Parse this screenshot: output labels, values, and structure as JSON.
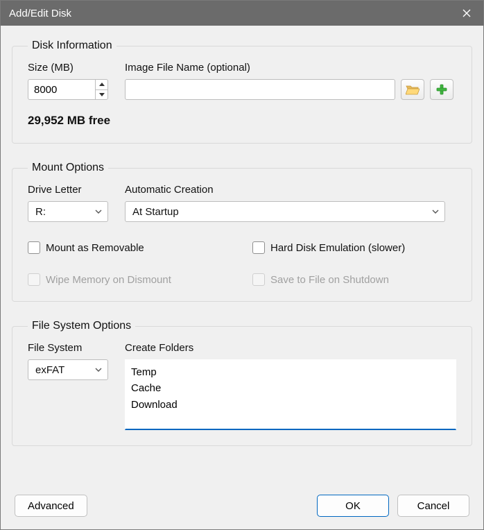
{
  "title": "Add/Edit Disk",
  "groups": {
    "disk": {
      "legend": "Disk Information",
      "size_label": "Size (MB)",
      "size_value": "8000",
      "image_label": "Image File Name (optional)",
      "image_value": "",
      "free_text": "29,952 MB free"
    },
    "mount": {
      "legend": "Mount Options",
      "drive_label": "Drive Letter",
      "drive_value": "R:",
      "auto_label": "Automatic Creation",
      "auto_value": "At Startup",
      "checks": {
        "removable": "Mount as Removable",
        "hdd": "Hard Disk Emulation (slower)",
        "wipe": "Wipe Memory on Dismount",
        "save": "Save to File on Shutdown"
      }
    },
    "fs": {
      "legend": "File System Options",
      "fs_label": "File System",
      "fs_value": "exFAT",
      "folders_label": "Create Folders",
      "folders_value": "Temp\nCache\nDownload"
    }
  },
  "buttons": {
    "advanced": "Advanced",
    "ok": "OK",
    "cancel": "Cancel"
  }
}
